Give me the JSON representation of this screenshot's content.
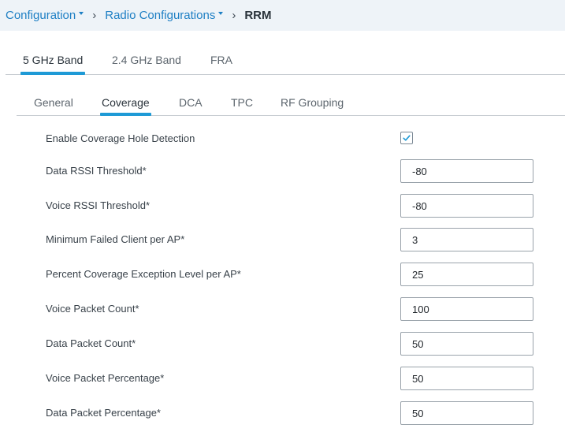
{
  "breadcrumb": {
    "items": [
      {
        "label": "Configuration",
        "has_dropdown": true
      },
      {
        "label": "Radio Configurations",
        "has_dropdown": true
      }
    ],
    "current": "RRM",
    "separator_icon": "chevron-right-icon"
  },
  "band_tabs": [
    {
      "label": "5 GHz Band",
      "active": true
    },
    {
      "label": "2.4 GHz Band",
      "active": false
    },
    {
      "label": "FRA",
      "active": false
    }
  ],
  "sub_tabs": [
    {
      "label": "General",
      "active": false
    },
    {
      "label": "Coverage",
      "active": true
    },
    {
      "label": "DCA",
      "active": false
    },
    {
      "label": "TPC",
      "active": false
    },
    {
      "label": "RF Grouping",
      "active": false
    }
  ],
  "form": {
    "enable_coverage_hole_detection": {
      "label": "Enable Coverage Hole Detection",
      "checked": true
    },
    "fields": [
      {
        "label": "Data RSSI Threshold*",
        "value": "-80"
      },
      {
        "label": "Voice RSSI Threshold*",
        "value": "-80"
      },
      {
        "label": "Minimum Failed Client per AP*",
        "value": "3"
      },
      {
        "label": "Percent Coverage Exception Level per AP*",
        "value": "25"
      },
      {
        "label": "Voice Packet Count*",
        "value": "100"
      },
      {
        "label": "Data Packet Count*",
        "value": "50"
      },
      {
        "label": "Voice Packet Percentage*",
        "value": "50"
      },
      {
        "label": "Data Packet Percentage*",
        "value": "50"
      }
    ]
  },
  "colors": {
    "accent": "#1e9ad6",
    "link": "#1e7fc4",
    "breadcrumb_bg": "#eef3f8"
  }
}
